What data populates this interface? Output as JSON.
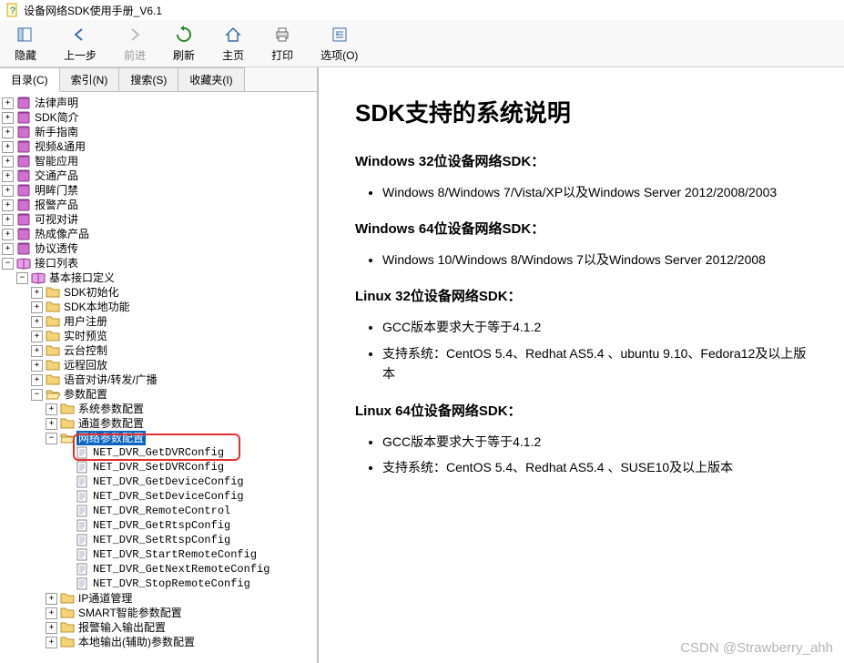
{
  "titlebar": {
    "text": "设备网络SDK使用手册_V6.1"
  },
  "toolbar": {
    "hide": "隐藏",
    "back": "上一步",
    "forward": "前进",
    "refresh": "刷新",
    "home": "主页",
    "print": "打印",
    "options": "选项(O)"
  },
  "tabs": {
    "contents": "目录(C)",
    "index": "索引(N)",
    "search": "搜索(S)",
    "favorites": "收藏夹(I)"
  },
  "tree": {
    "top": [
      "法律声明",
      "SDK简介",
      "新手指南",
      "视频&通用",
      "智能应用",
      "交通产品",
      "明眸门禁",
      "报警产品",
      "可视对讲",
      "热成像产品",
      "协议透传"
    ],
    "interface_list": "接口列表",
    "basic_def": "基本接口定义",
    "basic_children": [
      "SDK初始化",
      "SDK本地功能",
      "用户注册",
      "实时预览",
      "云台控制",
      "远程回放",
      "语音对讲/转发/广播"
    ],
    "param_config": "参数配置",
    "param_children_top": [
      "系统参数配置",
      "通道参数配置"
    ],
    "selected_node": "网络参数配置",
    "api_items": [
      "NET_DVR_GetDVRConfig",
      "NET_DVR_SetDVRConfig",
      "NET_DVR_GetDeviceConfig",
      "NET_DVR_SetDeviceConfig",
      "NET_DVR_RemoteControl",
      "NET_DVR_GetRtspConfig",
      "NET_DVR_SetRtspConfig",
      "NET_DVR_StartRemoteConfig",
      "NET_DVR_GetNextRemoteConfig",
      "NET_DVR_StopRemoteConfig"
    ],
    "param_children_bottom": [
      "IP通道管理",
      "SMART智能参数配置",
      "报警输入输出配置",
      "本地输出(辅助)参数配置"
    ]
  },
  "content": {
    "h1": "SDK支持的系统说明",
    "sec1_h": "Windows 32位设备网络SDK：",
    "sec1_i1": "Windows 8/Windows 7/Vista/XP以及Windows Server 2012/2008/2003",
    "sec2_h": "Windows 64位设备网络SDK：",
    "sec2_i1": "Windows 10/Windows 8/Windows 7以及Windows Server 2012/2008",
    "sec3_h": "Linux 32位设备网络SDK：",
    "sec3_i1": "GCC版本要求大于等于4.1.2",
    "sec3_i2": "支持系统：CentOS 5.4、Redhat AS5.4 、ubuntu 9.10、Fedora12及以上版本",
    "sec4_h": "Linux 64位设备网络SDK：",
    "sec4_i1": "GCC版本要求大于等于4.1.2",
    "sec4_i2": "支持系统：CentOS 5.4、Redhat AS5.4 、SUSE10及以上版本"
  },
  "watermark": "CSDN @Strawberry_ahh"
}
